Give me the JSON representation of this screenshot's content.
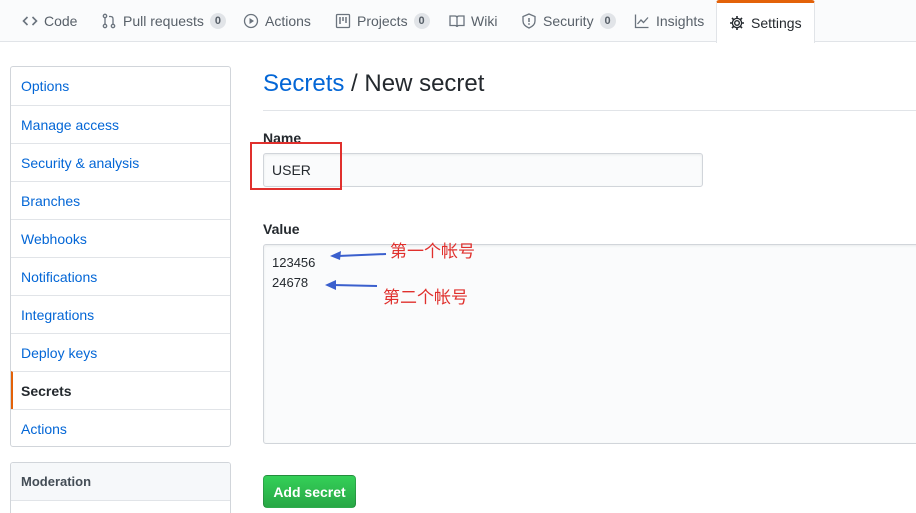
{
  "nav": {
    "tabs": [
      {
        "label": "Code",
        "icon": "code-icon"
      },
      {
        "label": "Pull requests",
        "icon": "pull-request-icon",
        "count": "0"
      },
      {
        "label": "Actions",
        "icon": "play-icon"
      },
      {
        "label": "Projects",
        "icon": "project-icon",
        "count": "0"
      },
      {
        "label": "Wiki",
        "icon": "book-icon"
      },
      {
        "label": "Security",
        "icon": "shield-icon",
        "count": "0"
      },
      {
        "label": "Insights",
        "icon": "graph-icon"
      },
      {
        "label": "Settings",
        "icon": "gear-icon",
        "selected": true
      }
    ]
  },
  "sidebar": {
    "items": [
      {
        "label": "Options"
      },
      {
        "label": "Manage access"
      },
      {
        "label": "Security & analysis"
      },
      {
        "label": "Branches"
      },
      {
        "label": "Webhooks"
      },
      {
        "label": "Notifications"
      },
      {
        "label": "Integrations"
      },
      {
        "label": "Deploy keys"
      },
      {
        "label": "Secrets",
        "selected": true
      },
      {
        "label": "Actions"
      }
    ],
    "section2_title": "Moderation"
  },
  "main": {
    "breadcrumb_link": "Secrets",
    "breadcrumb_sep": " / ",
    "title": "New secret",
    "name_label": "Name",
    "name_value": "USER",
    "value_label": "Value",
    "value_lines": [
      "123456",
      "24678"
    ],
    "submit_label": "Add secret"
  },
  "annotations": {
    "note1": "第一个帐号",
    "note2": "第二个帐号",
    "color": "#e0302d",
    "arrow_color": "#3a5fcd"
  },
  "colors": {
    "accent": "#e36209",
    "link": "#0366d6",
    "button": "#2ea44f"
  }
}
